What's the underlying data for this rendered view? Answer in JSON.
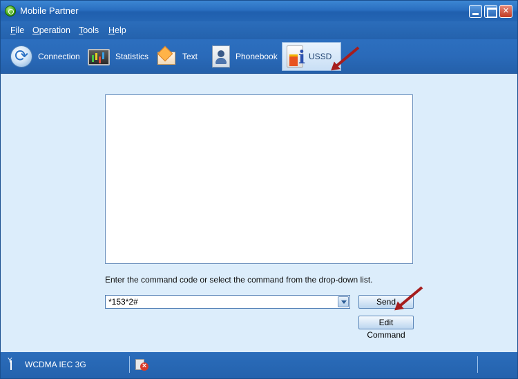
{
  "window": {
    "title": "Mobile Partner"
  },
  "menu": [
    {
      "label": "File",
      "underline": "F",
      "rest": "ile"
    },
    {
      "label": "Operation",
      "underline": "O",
      "rest": "peration"
    },
    {
      "label": "Tools",
      "underline": "T",
      "rest": "ools"
    },
    {
      "label": "Help",
      "underline": "H",
      "rest": "elp"
    }
  ],
  "toolbar": [
    {
      "label": "Connection",
      "icon": "connection-icon"
    },
    {
      "label": "Statistics",
      "icon": "statistics-icon"
    },
    {
      "label": "Text",
      "icon": "envelope-icon"
    },
    {
      "label": "Phonebook",
      "icon": "phonebook-icon"
    },
    {
      "label": "USSD",
      "icon": "ussd-icon",
      "active": true
    }
  ],
  "ussd": {
    "hint": "Enter the command code or select the command from the drop-down list.",
    "command_value": "*153*2#",
    "send_label": "Send",
    "edit_label": "Edit Command"
  },
  "status": {
    "network": "WCDMA  IEC 3G"
  },
  "colors": {
    "accent": "#2a6ab9",
    "arrow": "#a61d1d",
    "content_bg": "#dcedfb"
  }
}
